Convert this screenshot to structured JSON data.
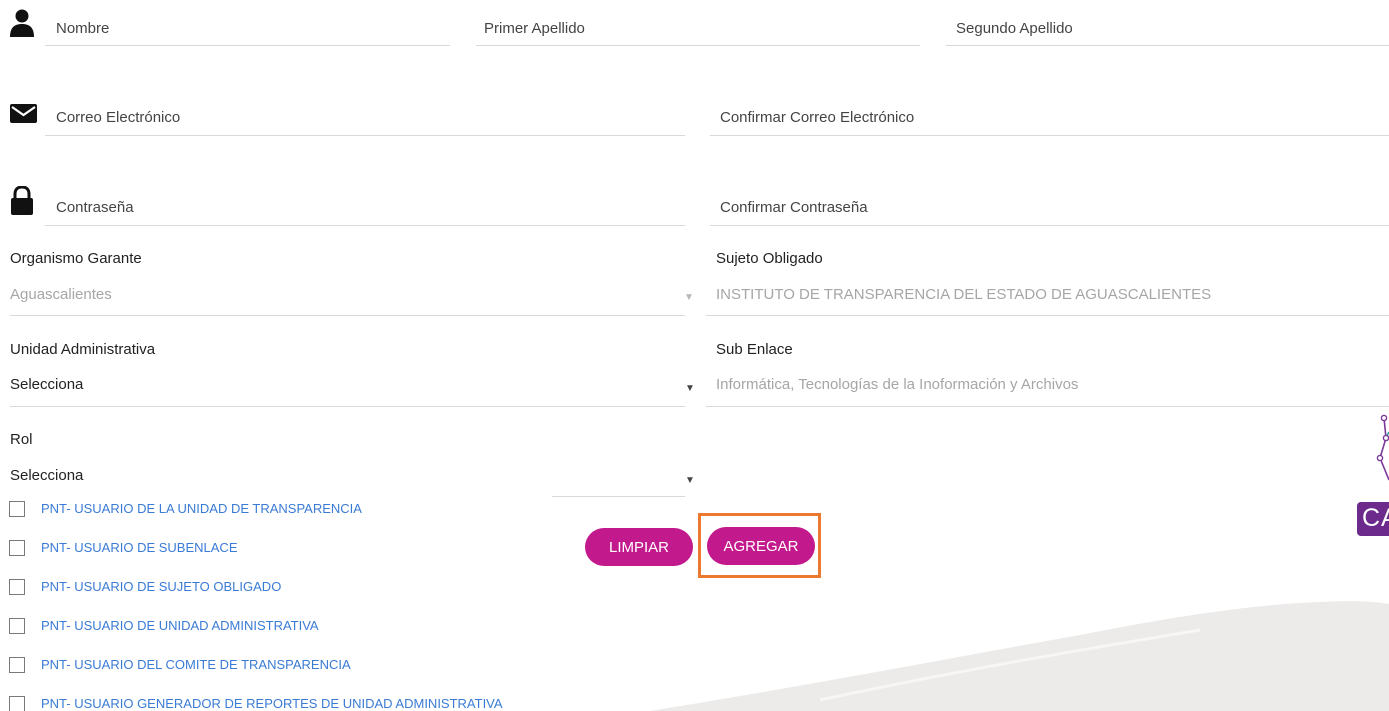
{
  "fields": {
    "nombre": "Nombre",
    "primer_apellido": "Primer Apellido",
    "segundo_apellido": "Segundo Apellido",
    "correo": "Correo Electrónico",
    "confirmar_correo": "Confirmar Correo Electrónico",
    "contrasena": "Contraseña",
    "confirmar_contrasena": "Confirmar Contraseña"
  },
  "organismo": {
    "label": "Organismo Garante",
    "value": "Aguascalientes"
  },
  "sujeto": {
    "label": "Sujeto Obligado",
    "value": "INSTITUTO DE TRANSPARENCIA DEL ESTADO DE AGUASCALIENTES"
  },
  "unidad": {
    "label": "Unidad Administrativa",
    "value": "Selecciona"
  },
  "subenlace": {
    "label": "Sub Enlace",
    "value": "Informática, Tecnologías de la Inoformación y Archivos"
  },
  "rol": {
    "label": "Rol",
    "value": "Selecciona",
    "options": [
      "PNT- USUARIO DE LA UNIDAD DE TRANSPARENCIA",
      "PNT- USUARIO DE SUBENLACE",
      "PNT- USUARIO DE SUJETO OBLIGADO",
      "PNT- USUARIO DE UNIDAD ADMINISTRATIVA",
      "PNT- USUARIO DEL COMITE DE TRANSPARENCIA",
      "PNT- USUARIO GENERADOR DE REPORTES DE UNIDAD ADMINISTRATIVA"
    ]
  },
  "buttons": {
    "limpiar": "LIMPIAR",
    "agregar": "AGREGAR"
  },
  "logo_text": "CA",
  "colors": {
    "accent": "#c2198c",
    "highlight": "#ec7a2e",
    "link": "#3a7bd5",
    "logo_purple": "#6b2a8c"
  }
}
